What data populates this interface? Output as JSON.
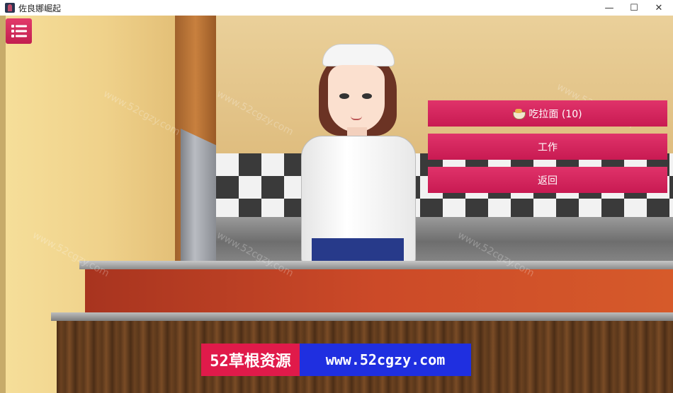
{
  "window": {
    "title": "佐良娜崛起",
    "minimize": "—",
    "maximize": "☐",
    "close": "✕"
  },
  "menu_button": {
    "icon": "menu-list-icon"
  },
  "choices": [
    {
      "label": "吃拉面 (10)",
      "icon": "ramen-bowl-icon"
    },
    {
      "label": "工作"
    },
    {
      "label": "返回"
    }
  ],
  "watermark": {
    "text": "www.52cgzy.com"
  },
  "banner": {
    "left": "52草根资源",
    "right": "www.52cgzy.com"
  },
  "colors": {
    "accent": "#d42a5e",
    "banner_red": "#e01a4a",
    "banner_blue": "#1f2fe0"
  }
}
